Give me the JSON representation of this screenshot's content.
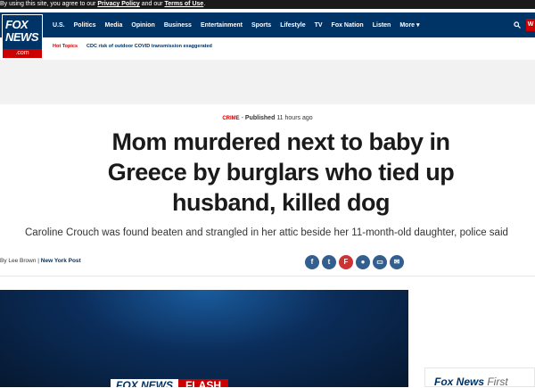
{
  "cookie": {
    "text": "By using this site, you agree to our ",
    "privacy_link": "Privacy Policy",
    "and_text": " and our ",
    "terms_link": "Terms of Use",
    "end": "."
  },
  "logo": {
    "line1": "FOX",
    "line2": "NEWS",
    "domain": ".com"
  },
  "nav": {
    "items": [
      "U.S.",
      "Politics",
      "Media",
      "Opinion",
      "Business",
      "Entertainment",
      "Sports",
      "Lifestyle",
      "TV",
      "Fox Nation",
      "Listen",
      "More"
    ],
    "more_chevron": "▾",
    "search_icon": "search-icon",
    "watch_label": "W"
  },
  "hot_topics": {
    "label": "Hot Topics",
    "items": [
      "CDC risk of outdoor COVID transmission exaggerated"
    ]
  },
  "article": {
    "category": "CRIME",
    "separator": "-",
    "published_label": "Published",
    "published_time": "11 hours ago",
    "headline": "Mom murdered next to baby in Greece by burglars who tied up husband, killed dog",
    "subhead": "Caroline Crouch was found beaten and strangled in her attic beside her 11-month-old daughter, police said",
    "byline_prefix": "By Lee Brown",
    "byline_sep": " | ",
    "publication": "New York Post"
  },
  "share": {
    "icons": [
      "facebook-icon",
      "twitter-icon",
      "flipboard-icon",
      "comments-icon",
      "print-icon",
      "email-icon"
    ],
    "glyphs": [
      "f",
      "t",
      "F",
      "●",
      "▭",
      "✉"
    ]
  },
  "video": {
    "banner_left": "FOX NEWS",
    "banner_right": "FLASH"
  },
  "promo": {
    "brand": "Fox News",
    "suffix": " First"
  },
  "colors": {
    "navy": "#003366",
    "red": "#cc0000"
  }
}
